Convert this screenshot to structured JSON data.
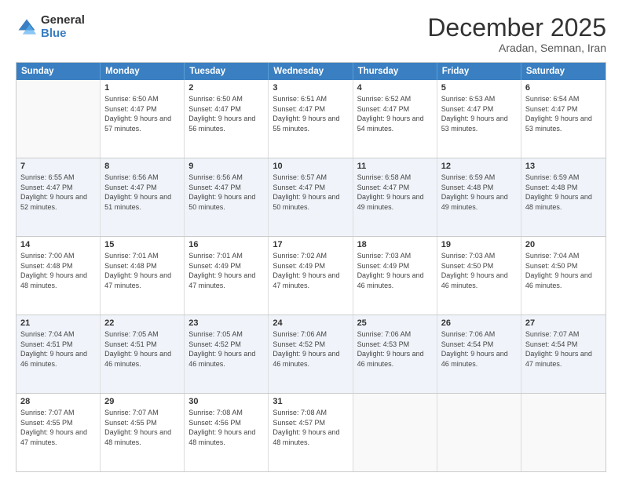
{
  "logo": {
    "general": "General",
    "blue": "Blue"
  },
  "title": "December 2025",
  "subtitle": "Aradan, Semnan, Iran",
  "header_days": [
    "Sunday",
    "Monday",
    "Tuesday",
    "Wednesday",
    "Thursday",
    "Friday",
    "Saturday"
  ],
  "weeks": [
    [
      {
        "day": "",
        "sunrise": "",
        "sunset": "",
        "daylight": "",
        "empty": true
      },
      {
        "day": "1",
        "sunrise": "Sunrise: 6:50 AM",
        "sunset": "Sunset: 4:47 PM",
        "daylight": "Daylight: 9 hours and 57 minutes."
      },
      {
        "day": "2",
        "sunrise": "Sunrise: 6:50 AM",
        "sunset": "Sunset: 4:47 PM",
        "daylight": "Daylight: 9 hours and 56 minutes."
      },
      {
        "day": "3",
        "sunrise": "Sunrise: 6:51 AM",
        "sunset": "Sunset: 4:47 PM",
        "daylight": "Daylight: 9 hours and 55 minutes."
      },
      {
        "day": "4",
        "sunrise": "Sunrise: 6:52 AM",
        "sunset": "Sunset: 4:47 PM",
        "daylight": "Daylight: 9 hours and 54 minutes."
      },
      {
        "day": "5",
        "sunrise": "Sunrise: 6:53 AM",
        "sunset": "Sunset: 4:47 PM",
        "daylight": "Daylight: 9 hours and 53 minutes."
      },
      {
        "day": "6",
        "sunrise": "Sunrise: 6:54 AM",
        "sunset": "Sunset: 4:47 PM",
        "daylight": "Daylight: 9 hours and 53 minutes."
      }
    ],
    [
      {
        "day": "7",
        "sunrise": "Sunrise: 6:55 AM",
        "sunset": "Sunset: 4:47 PM",
        "daylight": "Daylight: 9 hours and 52 minutes."
      },
      {
        "day": "8",
        "sunrise": "Sunrise: 6:56 AM",
        "sunset": "Sunset: 4:47 PM",
        "daylight": "Daylight: 9 hours and 51 minutes."
      },
      {
        "day": "9",
        "sunrise": "Sunrise: 6:56 AM",
        "sunset": "Sunset: 4:47 PM",
        "daylight": "Daylight: 9 hours and 50 minutes."
      },
      {
        "day": "10",
        "sunrise": "Sunrise: 6:57 AM",
        "sunset": "Sunset: 4:47 PM",
        "daylight": "Daylight: 9 hours and 50 minutes."
      },
      {
        "day": "11",
        "sunrise": "Sunrise: 6:58 AM",
        "sunset": "Sunset: 4:47 PM",
        "daylight": "Daylight: 9 hours and 49 minutes."
      },
      {
        "day": "12",
        "sunrise": "Sunrise: 6:59 AM",
        "sunset": "Sunset: 4:48 PM",
        "daylight": "Daylight: 9 hours and 49 minutes."
      },
      {
        "day": "13",
        "sunrise": "Sunrise: 6:59 AM",
        "sunset": "Sunset: 4:48 PM",
        "daylight": "Daylight: 9 hours and 48 minutes."
      }
    ],
    [
      {
        "day": "14",
        "sunrise": "Sunrise: 7:00 AM",
        "sunset": "Sunset: 4:48 PM",
        "daylight": "Daylight: 9 hours and 48 minutes."
      },
      {
        "day": "15",
        "sunrise": "Sunrise: 7:01 AM",
        "sunset": "Sunset: 4:48 PM",
        "daylight": "Daylight: 9 hours and 47 minutes."
      },
      {
        "day": "16",
        "sunrise": "Sunrise: 7:01 AM",
        "sunset": "Sunset: 4:49 PM",
        "daylight": "Daylight: 9 hours and 47 minutes."
      },
      {
        "day": "17",
        "sunrise": "Sunrise: 7:02 AM",
        "sunset": "Sunset: 4:49 PM",
        "daylight": "Daylight: 9 hours and 47 minutes."
      },
      {
        "day": "18",
        "sunrise": "Sunrise: 7:03 AM",
        "sunset": "Sunset: 4:49 PM",
        "daylight": "Daylight: 9 hours and 46 minutes."
      },
      {
        "day": "19",
        "sunrise": "Sunrise: 7:03 AM",
        "sunset": "Sunset: 4:50 PM",
        "daylight": "Daylight: 9 hours and 46 minutes."
      },
      {
        "day": "20",
        "sunrise": "Sunrise: 7:04 AM",
        "sunset": "Sunset: 4:50 PM",
        "daylight": "Daylight: 9 hours and 46 minutes."
      }
    ],
    [
      {
        "day": "21",
        "sunrise": "Sunrise: 7:04 AM",
        "sunset": "Sunset: 4:51 PM",
        "daylight": "Daylight: 9 hours and 46 minutes."
      },
      {
        "day": "22",
        "sunrise": "Sunrise: 7:05 AM",
        "sunset": "Sunset: 4:51 PM",
        "daylight": "Daylight: 9 hours and 46 minutes."
      },
      {
        "day": "23",
        "sunrise": "Sunrise: 7:05 AM",
        "sunset": "Sunset: 4:52 PM",
        "daylight": "Daylight: 9 hours and 46 minutes."
      },
      {
        "day": "24",
        "sunrise": "Sunrise: 7:06 AM",
        "sunset": "Sunset: 4:52 PM",
        "daylight": "Daylight: 9 hours and 46 minutes."
      },
      {
        "day": "25",
        "sunrise": "Sunrise: 7:06 AM",
        "sunset": "Sunset: 4:53 PM",
        "daylight": "Daylight: 9 hours and 46 minutes."
      },
      {
        "day": "26",
        "sunrise": "Sunrise: 7:06 AM",
        "sunset": "Sunset: 4:54 PM",
        "daylight": "Daylight: 9 hours and 46 minutes."
      },
      {
        "day": "27",
        "sunrise": "Sunrise: 7:07 AM",
        "sunset": "Sunset: 4:54 PM",
        "daylight": "Daylight: 9 hours and 47 minutes."
      }
    ],
    [
      {
        "day": "28",
        "sunrise": "Sunrise: 7:07 AM",
        "sunset": "Sunset: 4:55 PM",
        "daylight": "Daylight: 9 hours and 47 minutes."
      },
      {
        "day": "29",
        "sunrise": "Sunrise: 7:07 AM",
        "sunset": "Sunset: 4:55 PM",
        "daylight": "Daylight: 9 hours and 48 minutes."
      },
      {
        "day": "30",
        "sunrise": "Sunrise: 7:08 AM",
        "sunset": "Sunset: 4:56 PM",
        "daylight": "Daylight: 9 hours and 48 minutes."
      },
      {
        "day": "31",
        "sunrise": "Sunrise: 7:08 AM",
        "sunset": "Sunset: 4:57 PM",
        "daylight": "Daylight: 9 hours and 48 minutes."
      },
      {
        "day": "",
        "sunrise": "",
        "sunset": "",
        "daylight": "",
        "empty": true
      },
      {
        "day": "",
        "sunrise": "",
        "sunset": "",
        "daylight": "",
        "empty": true
      },
      {
        "day": "",
        "sunrise": "",
        "sunset": "",
        "daylight": "",
        "empty": true
      }
    ]
  ]
}
